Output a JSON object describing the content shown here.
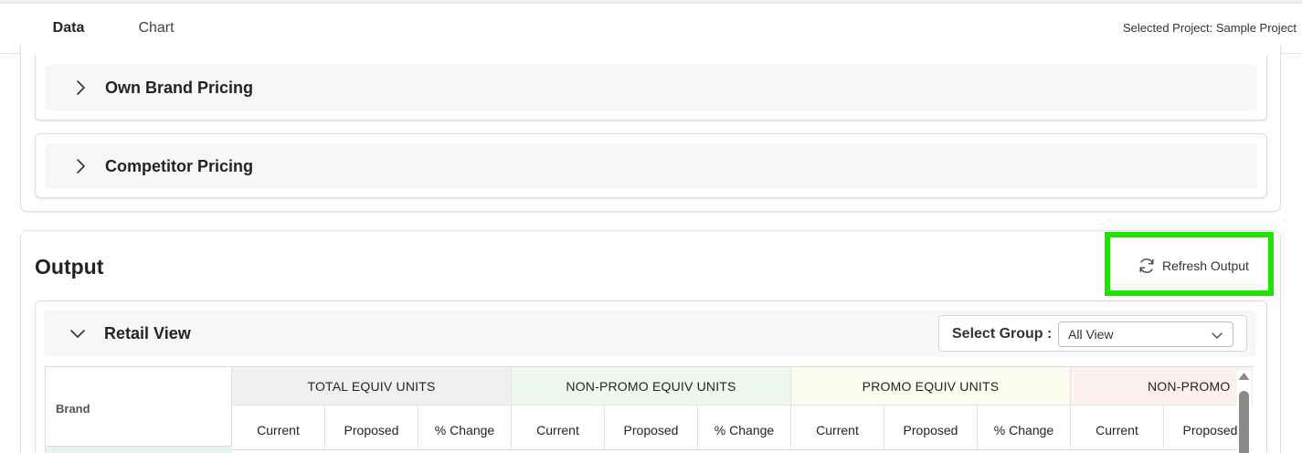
{
  "tabs": [
    {
      "label": "Data",
      "active": true
    },
    {
      "label": "Chart",
      "active": false
    }
  ],
  "header": {
    "selected_project": "Selected Project: Sample Project"
  },
  "inputs": {
    "sections": [
      {
        "label": "Own Brand Pricing",
        "expanded": false
      },
      {
        "label": "Competitor Pricing",
        "expanded": false
      }
    ]
  },
  "output": {
    "title": "Output",
    "refresh_label": "Refresh Output",
    "retail_view": {
      "title": "Retail View",
      "expanded": true,
      "group_label": "Select Group :",
      "group_value": "All View"
    },
    "table": {
      "brand_header": "Brand",
      "groups": [
        "TOTAL EQUIV UNITS",
        "NON-PROMO EQUIV UNITS",
        "PROMO EQUIV UNITS",
        "NON-PROMO"
      ],
      "subheaders": [
        "Current",
        "Proposed",
        "% Change",
        "Current",
        "Proposed",
        "% Change",
        "Current",
        "Proposed",
        "% Change",
        "Current",
        "Proposed"
      ]
    }
  },
  "colors": {
    "accent": "#1e6e58",
    "highlight": "#22e000",
    "total_bg": "#f0f0f0",
    "nonpromo_bg": "#eef8ef",
    "promo_bg": "#fcfcef",
    "nonpromo2_bg": "#fdf1ef"
  }
}
